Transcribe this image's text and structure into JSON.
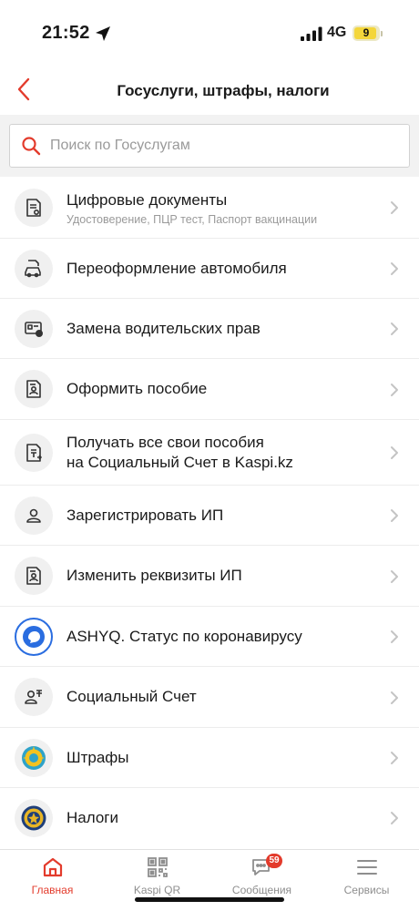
{
  "status": {
    "time": "21:52",
    "network": "4G",
    "battery": "9"
  },
  "header": {
    "title": "Госуслуги, штрафы, налоги"
  },
  "search": {
    "placeholder": "Поиск по Госуслугам",
    "value": ""
  },
  "items": [
    {
      "title": "Цифровые документы",
      "subtitle": "Удостоверение, ПЦР тест, Паспорт вакцинации",
      "icon": "digital-documents-icon"
    },
    {
      "title": "Переоформление автомобиля",
      "icon": "car-icon"
    },
    {
      "title": "Замена водительских прав",
      "icon": "driver-license-icon"
    },
    {
      "title": "Оформить пособие",
      "icon": "benefit-document-icon"
    },
    {
      "title_line1": "Получать все свои пособия",
      "title_line2": "на Социальный Счет в Kaspi.kz",
      "icon": "tenge-document-icon"
    },
    {
      "title": "Зарегистрировать ИП",
      "icon": "user-icon"
    },
    {
      "title": "Изменить реквизиты ИП",
      "icon": "profile-document-icon"
    },
    {
      "title": "ASHYQ. Статус по коронавирусу",
      "icon": "ashyq-logo-icon"
    },
    {
      "title": "Социальный Счет",
      "icon": "social-account-icon"
    },
    {
      "title": "Штрафы",
      "icon": "kazakhstan-emblem-icon"
    },
    {
      "title": "Налоги",
      "icon": "tax-committee-emblem-icon"
    }
  ],
  "tabs": [
    {
      "label": "Главная",
      "icon": "home-icon",
      "active": true
    },
    {
      "label": "Kaspi QR",
      "icon": "qr-code-icon",
      "active": false
    },
    {
      "label": "Сообщения",
      "icon": "messages-icon",
      "active": false,
      "badge": "59"
    },
    {
      "label": "Сервисы",
      "icon": "menu-icon",
      "active": false
    }
  ],
  "colors": {
    "accent": "#e33b2c",
    "icon_bg": "#f0f0f0",
    "muted_text": "#9a9a9a"
  }
}
